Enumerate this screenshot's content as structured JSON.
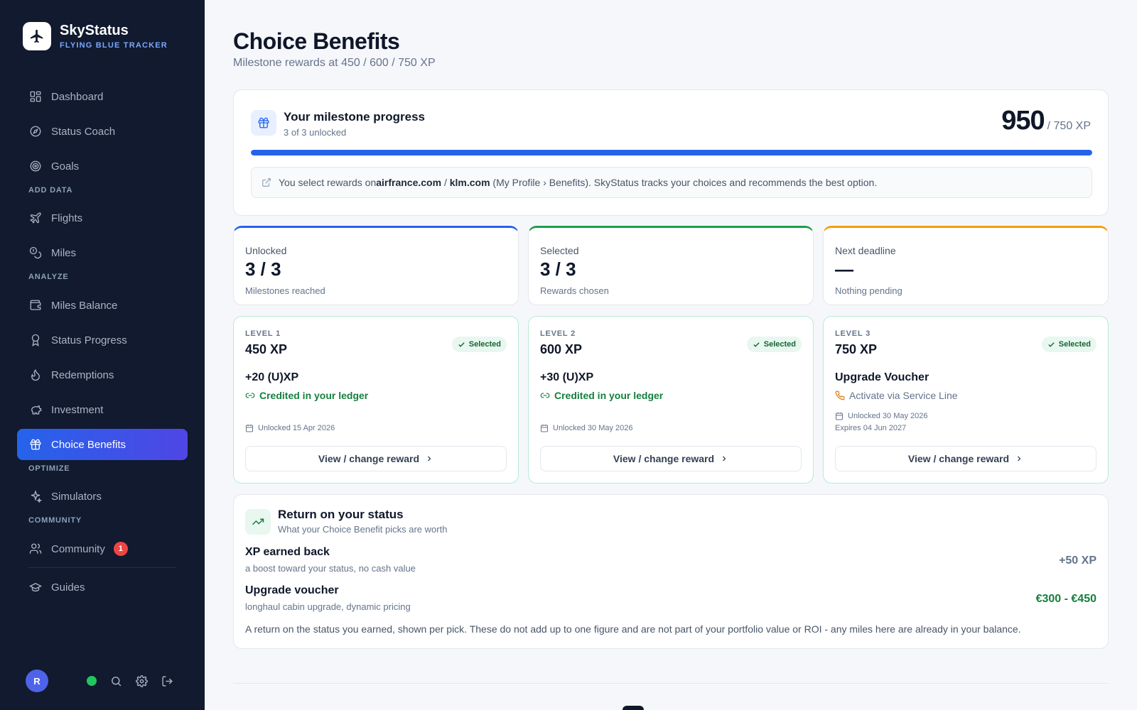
{
  "brand": {
    "name": "SkyStatus",
    "subtitle": "FLYING BLUE TRACKER"
  },
  "nav": {
    "dashboard": "Dashboard",
    "status_coach": "Status Coach",
    "goals": "Goals",
    "section_add": "ADD DATA",
    "flights": "Flights",
    "miles": "Miles",
    "section_analyze": "ANALYZE",
    "miles_balance": "Miles Balance",
    "status_progress": "Status Progress",
    "redemptions": "Redemptions",
    "investment": "Investment",
    "choice_benefits": "Choice Benefits",
    "section_optimize": "OPTIMIZE",
    "simulators": "Simulators",
    "section_community": "COMMUNITY",
    "community": "Community",
    "community_badge": "1",
    "guides": "Guides"
  },
  "user": {
    "initial": "R"
  },
  "page": {
    "title": "Choice Benefits",
    "subtitle": "Milestone rewards at 450 / 600 / 750 XP"
  },
  "progress": {
    "title": "Your milestone progress",
    "subtitle": "3 of 3 unlocked",
    "xp_current": "950",
    "xp_target": "/ 750 XP",
    "fill_fraction": 1.0,
    "note_prefix": "You select rewards on ",
    "note_site1": "airfrance.com",
    "note_sep": " / ",
    "note_site2": "klm.com",
    "note_suffix": " (My Profile › Benefits). SkyStatus tracks your choices and recommends the best option."
  },
  "stats": [
    {
      "label": "Unlocked",
      "value": "3 / 3",
      "note": "Milestones reached",
      "accent": "#2563eb"
    },
    {
      "label": "Selected",
      "value": "3 / 3",
      "note": "Rewards chosen",
      "accent": "#16a34a"
    },
    {
      "label": "Next deadline",
      "value": "—",
      "note": "Nothing pending",
      "accent": "#f59e0b"
    }
  ],
  "levels": [
    {
      "tag": "LEVEL 1",
      "xp": "450 XP",
      "badge": "Selected",
      "reward": "+20 (U)XP",
      "detail": "Credited in your ledger",
      "date1": "Unlocked 15 Apr 2026",
      "date2": "",
      "button": "View / change reward"
    },
    {
      "tag": "LEVEL 2",
      "xp": "600 XP",
      "badge": "Selected",
      "reward": "+30 (U)XP",
      "detail": "Credited in your ledger",
      "date1": "Unlocked 30 May 2026",
      "date2": "",
      "button": "View / change reward"
    },
    {
      "tag": "LEVEL 3",
      "xp": "750 XP",
      "badge": "Selected",
      "reward": "Upgrade Voucher",
      "detail": "Activate via Service Line",
      "date1": "Unlocked 30 May 2026",
      "date2": "Expires 04 Jun 2027",
      "button": "View / change reward"
    }
  ],
  "roi": {
    "title": "Return on your status",
    "subtitle": "What your Choice Benefit picks are worth",
    "rows": [
      {
        "title": "XP earned back",
        "sub": "a boost toward your status, no cash value",
        "value": "+50 XP",
        "color": "#64748b"
      },
      {
        "title": "Upgrade voucher",
        "sub": "longhaul cabin upgrade, dynamic pricing",
        "value": "€300 - €450",
        "color": "#15803d"
      }
    ],
    "footnote": "A return on the status you earned, shown per pick. These do not add up to one figure and are not part of your portfolio value or ROI - any miles here are already in your balance."
  },
  "colors": {
    "sidebar": "#111a2e",
    "accent": "#2563eb",
    "success": "#16a34a",
    "warning": "#f59e0b"
  }
}
